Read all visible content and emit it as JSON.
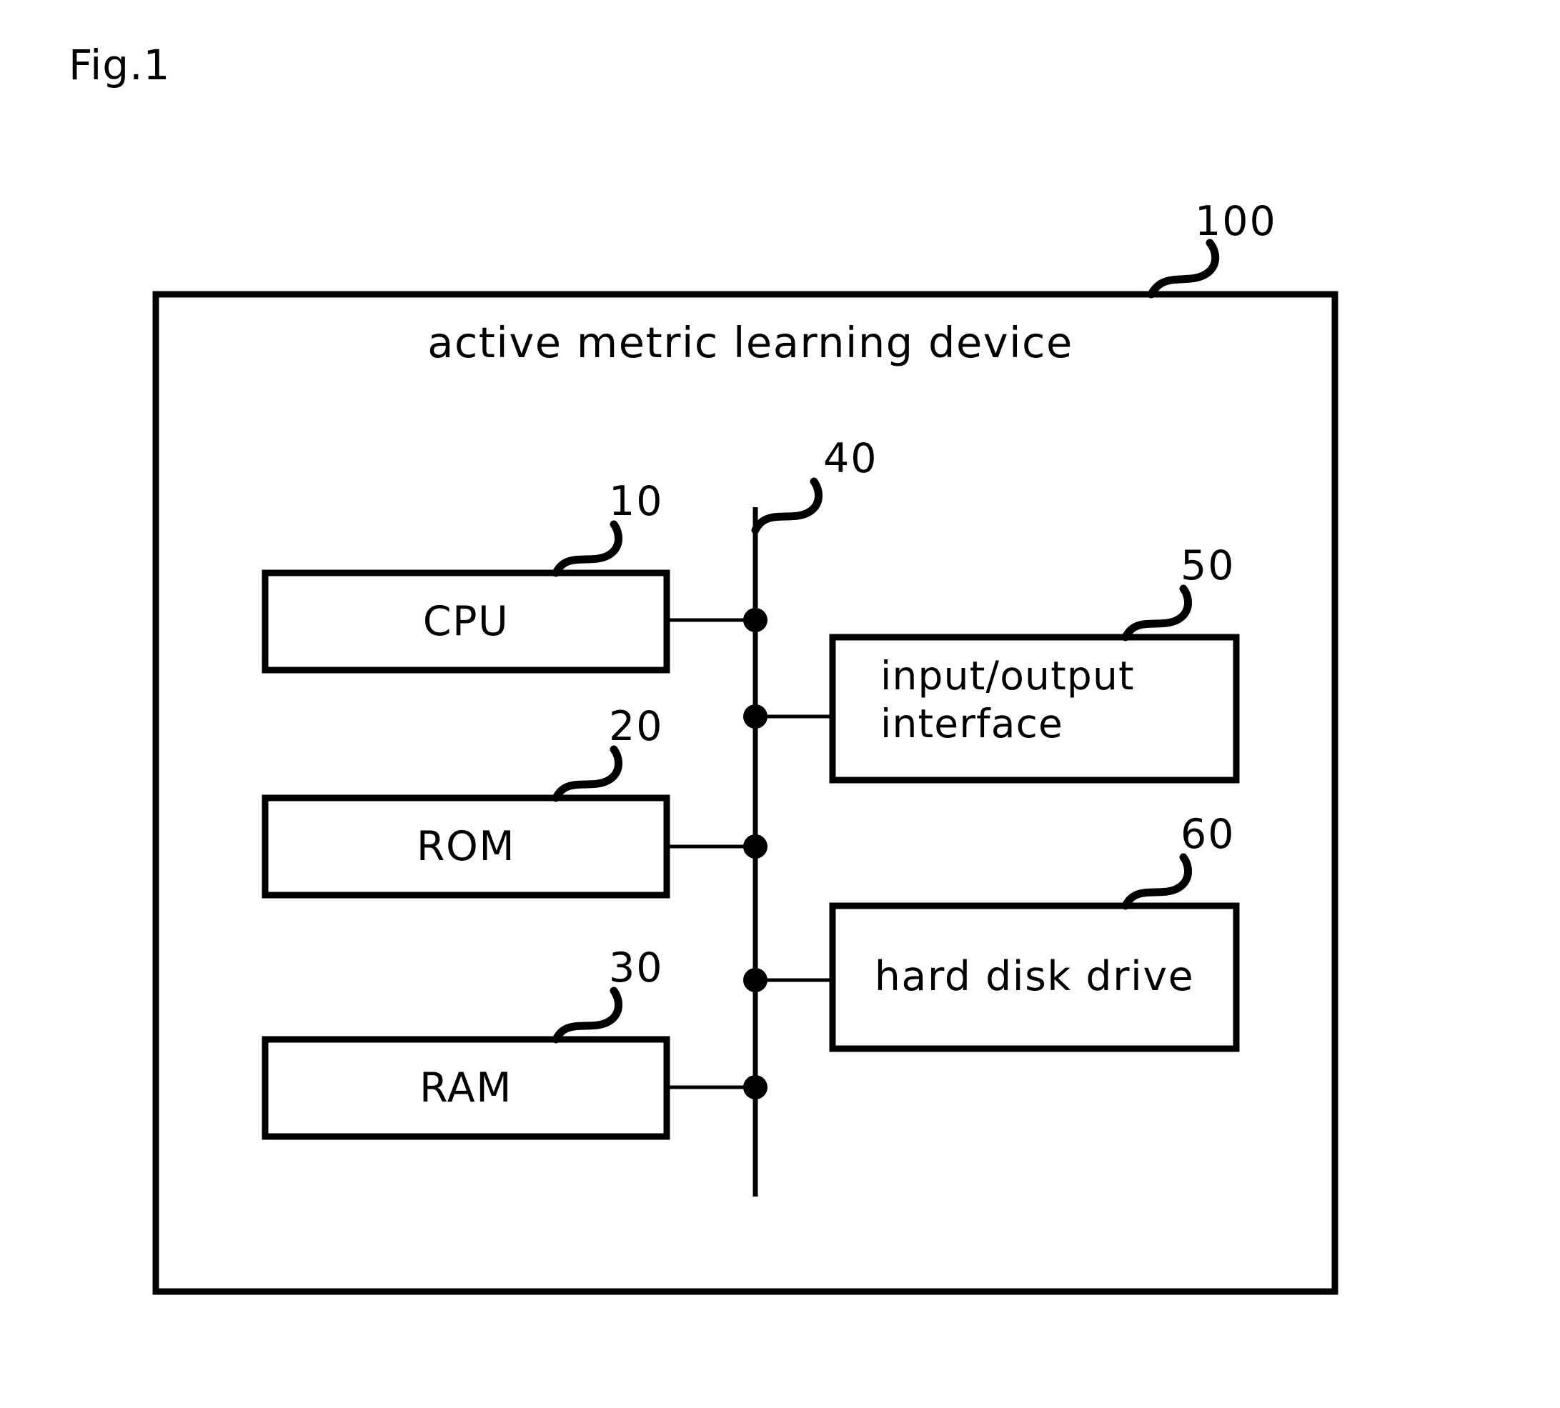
{
  "figure": {
    "label": "Fig.1",
    "device_title": "active metric learning device",
    "device_ref": "100"
  },
  "blocks": [
    {
      "key": "cpu",
      "label": "CPU",
      "ref": "10"
    },
    {
      "key": "rom",
      "label": "ROM",
      "ref": "20"
    },
    {
      "key": "ram",
      "label": "RAM",
      "ref": "30"
    },
    {
      "key": "bus",
      "label": "",
      "ref": "40"
    },
    {
      "key": "io",
      "label": "input/output\ninterface",
      "ref": "50"
    },
    {
      "key": "hdd",
      "label": "hard disk drive",
      "ref": "60"
    }
  ],
  "text": {
    "cpu_label": "CPU",
    "rom_label": "ROM",
    "ram_label": "RAM",
    "io_label": "input/output\ninterface",
    "hdd_label": "hard disk drive",
    "cpu_ref": "10",
    "rom_ref": "20",
    "ram_ref": "30",
    "bus_ref": "40",
    "io_ref": "50",
    "hdd_ref": "60",
    "outer_ref": "100"
  },
  "colors": {
    "stroke": "#000000",
    "background": "#ffffff"
  }
}
